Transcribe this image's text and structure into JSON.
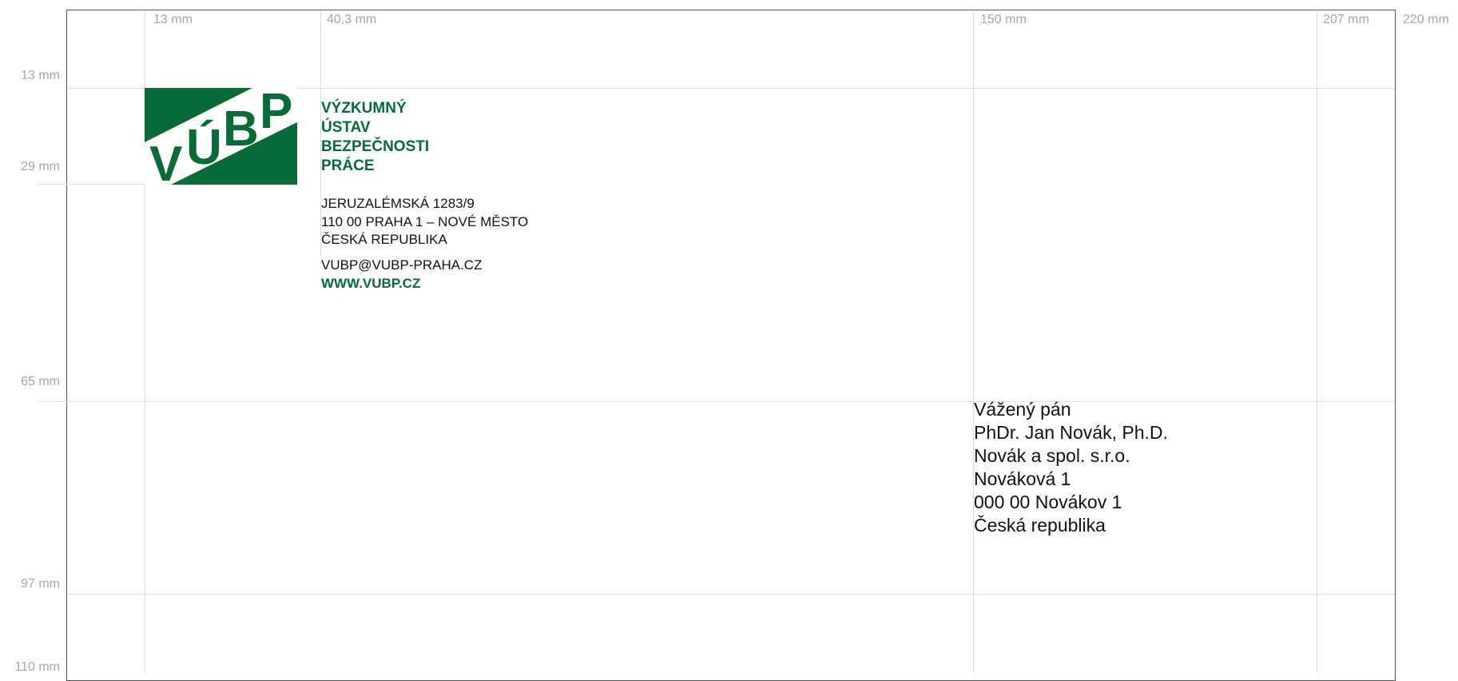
{
  "ruler": {
    "top": [
      "13 mm",
      "40,3 mm",
      "150 mm",
      "207 mm",
      "220 mm"
    ],
    "left": [
      "13 mm",
      "29 mm",
      "65 mm",
      "97 mm",
      "110 mm"
    ]
  },
  "logo": {
    "text": "VÚBP",
    "color": "#076b38"
  },
  "organization": {
    "lines": [
      "VÝZKUMNÝ",
      "ÚSTAV",
      "BEZPEČNOSTI",
      "PRÁCE"
    ],
    "color": "#076b38"
  },
  "address": {
    "lines": [
      "JERUZALÉMSKÁ 1283/9",
      "110 00  PRAHA 1 – NOVÉ MĚSTO",
      "ČESKÁ REPUBLIKA"
    ]
  },
  "contact": {
    "email": "VUBP@VUBP-PRAHA.CZ",
    "web": "WWW.VUBP.CZ"
  },
  "recipient": {
    "lines": [
      "Vážený pán",
      "PhDr. Jan Novák, Ph.D.",
      "Novák a spol. s.r.o.",
      "Nováková 1",
      "000 00  Novákov 1",
      "Česká republika"
    ]
  }
}
